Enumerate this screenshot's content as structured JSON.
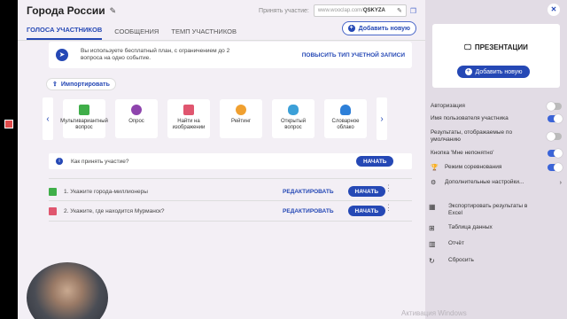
{
  "header": {
    "title": "Города России",
    "join_label": "Принять участие:",
    "join_url_prefix": "www.wooclap.com/",
    "join_code": "QSKYZA"
  },
  "tabs": [
    {
      "label": "ГОЛОСА УЧАСТНИКОВ",
      "active": true
    },
    {
      "label": "СООБЩЕНИЯ",
      "active": false
    },
    {
      "label": "ТЕМП УЧАСТНИКОВ",
      "active": false
    }
  ],
  "add_new_label": "Добавить новую",
  "notice": {
    "text": "Вы используете бесплатный план, с ограничением до 2 вопроса на одно событие.",
    "upgrade_label": "ПОВЫСИТЬ ТИП УЧЕТНОЙ ЗАПИСИ"
  },
  "import_label": "Импортировать",
  "question_types": [
    {
      "label": "Мультивариантный вопрос",
      "icon": "multiple-choice-icon",
      "color": "#3fae49"
    },
    {
      "label": "Опрос",
      "icon": "poll-icon",
      "color": "#8e44ad"
    },
    {
      "label": "Найти на изображении",
      "icon": "image-icon",
      "color": "#e0566f"
    },
    {
      "label": "Рейтинг",
      "icon": "rating-icon",
      "color": "#f0a030"
    },
    {
      "label": "Открытый вопрос",
      "icon": "open-question-icon",
      "color": "#3ca0d8"
    },
    {
      "label": "Словарное облако",
      "icon": "word-cloud-icon",
      "color": "#2d7fd8"
    }
  ],
  "how_to_join": {
    "text": "Как принять участие?",
    "start_label": "НАЧАТЬ"
  },
  "questions": [
    {
      "number": "1.",
      "text": "Укажите города-миллионеры",
      "edit_label": "РЕДАКТИРОВАТЬ",
      "start_label": "НАЧАТЬ",
      "icon_color": "#3fae49"
    },
    {
      "number": "2.",
      "text": "Укажите, где находится Мурманск?",
      "edit_label": "РЕДАКТИРОВАТЬ",
      "start_label": "НАЧАТЬ",
      "icon_color": "#e0566f"
    }
  ],
  "sidebar": {
    "presentations_label": "ПРЕЗЕНТАЦИИ",
    "add_new_label": "Добавить новую",
    "options": [
      {
        "label": "Авторизация",
        "on": false
      },
      {
        "label": "Имя пользователя участника",
        "on": true
      },
      {
        "label": "Результаты, отображаемые по умолчанию",
        "on": false
      },
      {
        "label": "Кнопка 'Мне непонятно'",
        "on": true
      },
      {
        "label": "Режим соревнования",
        "on": true,
        "icon": "trophy-icon"
      },
      {
        "label": "Дополнительные настройки...",
        "icon": "gear-icon"
      }
    ],
    "actions": [
      {
        "label": "Экспортировать результаты в Excel",
        "icon": "excel-icon"
      },
      {
        "label": "Таблица данных",
        "icon": "grid-icon"
      },
      {
        "label": "Отчёт",
        "icon": "chart-icon"
      },
      {
        "label": "Сбросить",
        "icon": "reset-icon"
      }
    ]
  },
  "watermark": "Активация Windows",
  "accent_color": "#2548b5"
}
